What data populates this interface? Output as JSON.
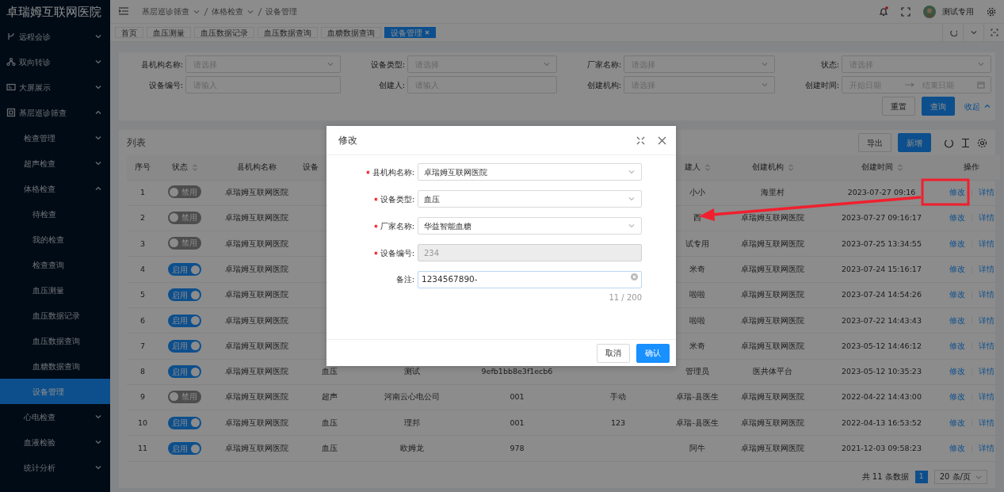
{
  "app": {
    "title": "卓瑞姆互联网医院"
  },
  "sidebar": {
    "items": [
      {
        "label": "远程会诊",
        "expanded": false,
        "selected": false
      },
      {
        "label": "双向转诊",
        "expanded": false,
        "selected": false
      },
      {
        "label": "大屏展示",
        "expanded": false,
        "selected": false
      },
      {
        "label": "基层巡诊筛查",
        "expanded": true,
        "selected": false,
        "children": [
          {
            "label": "检查管理",
            "expanded": false,
            "selected": false
          },
          {
            "label": "超声检查",
            "expanded": false,
            "selected": false
          },
          {
            "label": "体格检查",
            "expanded": true,
            "selected": false,
            "children": [
              {
                "label": "待检查",
                "selected": false
              },
              {
                "label": "我的检查",
                "selected": false
              },
              {
                "label": "检查查询",
                "selected": false
              },
              {
                "label": "血压测量",
                "selected": false
              },
              {
                "label": "血压数据记录",
                "selected": false
              },
              {
                "label": "血压数据查询",
                "selected": false
              },
              {
                "label": "血糖数据查询",
                "selected": false
              },
              {
                "label": "设备管理",
                "selected": true
              }
            ]
          },
          {
            "label": "心电检查",
            "expanded": false,
            "selected": false
          },
          {
            "label": "血液检验",
            "expanded": false,
            "selected": false
          },
          {
            "label": "统计分析",
            "expanded": false,
            "selected": false
          }
        ]
      }
    ]
  },
  "breadcrumbs": [
    {
      "label": "基层巡诊筛查",
      "dropdown": true
    },
    {
      "label": "体格检查",
      "dropdown": true
    },
    {
      "label": "设备管理",
      "dropdown": false
    }
  ],
  "user": {
    "name": "测试专用",
    "notification": true
  },
  "tabs": [
    {
      "label": "首页",
      "selected": false
    },
    {
      "label": "血压测量",
      "selected": false
    },
    {
      "label": "血压数据记录",
      "selected": false
    },
    {
      "label": "血压数据查询",
      "selected": false
    },
    {
      "label": "血糖数据查询",
      "selected": false
    },
    {
      "label": "设备管理",
      "selected": true
    }
  ],
  "filters": [
    {
      "label": "县机构名称:",
      "kind": "select",
      "placeholder": "请选择"
    },
    {
      "label": "设备类型:",
      "kind": "select",
      "placeholder": "请选择"
    },
    {
      "label": "厂家名称:",
      "kind": "select",
      "placeholder": "请选择"
    },
    {
      "label": "状态:",
      "kind": "select",
      "placeholder": "请选择"
    },
    {
      "label": "设备编号:",
      "kind": "input",
      "placeholder": "请输入"
    },
    {
      "label": "创建人:",
      "kind": "input",
      "placeholder": "请输入"
    },
    {
      "label": "创建机构:",
      "kind": "select",
      "placeholder": "请选择"
    },
    {
      "label": "创建时间:",
      "kind": "daterange",
      "placeholder": "开始日期",
      "placeholder_end": "结束日期"
    }
  ],
  "filter_actions": {
    "reset": "重置",
    "search": "查询",
    "collapse": "收起"
  },
  "table": {
    "title": "列表",
    "export": "导出",
    "add": "新增",
    "columns": [
      {
        "label": "序号",
        "sortable": false
      },
      {
        "label": "状态",
        "sortable": true
      },
      {
        "label": "县机构名称",
        "sortable": false
      },
      {
        "label": "设备"
      },
      null,
      null,
      null,
      {
        "label": "建人",
        "sortable": true
      },
      {
        "label": "创建机构",
        "sortable": true
      },
      {
        "label": "创建时间",
        "sortable": true
      },
      {
        "label": "操作",
        "sortable": false
      }
    ],
    "rows": [
      {
        "cells": [
          "1",
          {
            "on": false,
            "label": "禁用"
          },
          "卓瑞姆互联网医院",
          null,
          null,
          null,
          null,
          "小小",
          "海里村",
          "2023-07-27 09:16",
          [
            "修改",
            "详情"
          ]
        ]
      },
      {
        "cells": [
          "2",
          {
            "on": false,
            "label": "禁用"
          },
          "卓瑞姆互联网医院",
          null,
          null,
          null,
          null,
          "西",
          "卓瑞姆互联网医院",
          "2023-07-27 09:16:17",
          [
            "修改",
            "详情"
          ]
        ]
      },
      {
        "cells": [
          "3",
          {
            "on": false,
            "label": "禁用"
          },
          "卓瑞姆互联网医院",
          null,
          null,
          null,
          null,
          "试专用",
          "卓瑞姆互联网医院",
          "2023-07-25 13:34:55",
          [
            "修改",
            "详情"
          ]
        ]
      },
      {
        "cells": [
          "4",
          {
            "on": true,
            "label": "启用"
          },
          "卓瑞姆互联网医院",
          null,
          null,
          null,
          null,
          "米奇",
          "卓瑞姆互联网医院",
          "2023-07-24 15:16:17",
          [
            "修改",
            "详情"
          ]
        ]
      },
      {
        "cells": [
          "5",
          {
            "on": true,
            "label": "启用"
          },
          "卓瑞姆互联网医院",
          null,
          null,
          null,
          null,
          "啦啦",
          "卓瑞姆互联网医院",
          "2023-07-24 14:54:26",
          [
            "修改",
            "详情"
          ]
        ]
      },
      {
        "cells": [
          "6",
          {
            "on": true,
            "label": "启用"
          },
          "卓瑞姆互联网医院",
          null,
          null,
          null,
          null,
          "啦啦",
          "卓瑞姆互联网医院",
          "2023-07-22 14:43:43",
          [
            "修改",
            "详情"
          ]
        ]
      },
      {
        "cells": [
          "7",
          {
            "on": true,
            "label": "启用"
          },
          "卓瑞姆互联网医院",
          null,
          null,
          null,
          null,
          "米奇",
          "卓瑞姆互联网医院",
          "2023-05-12 14:46:12",
          [
            "修改",
            "详情"
          ]
        ]
      },
      {
        "cells": [
          "8",
          {
            "on": true,
            "label": "启用"
          },
          "卓瑞姆互联网医院",
          "血压",
          "测试",
          "9efb1bb8e3f1ecb6",
          null,
          "管理员",
          "医共体平台",
          "2023-05-12 10:35:23",
          [
            "修改",
            "详情"
          ]
        ]
      },
      {
        "cells": [
          "9",
          {
            "on": false,
            "label": "禁用"
          },
          "卓瑞姆互联网医院",
          "超声",
          "河南云心电公司",
          "001",
          "手动",
          "卓瑞-县医生",
          "卓瑞姆互联网医院",
          "2022-04-22 14:43:00",
          [
            "修改",
            "详情"
          ]
        ]
      },
      {
        "cells": [
          "10",
          {
            "on": true,
            "label": "启用"
          },
          "卓瑞姆互联网医院",
          "血压",
          "理邦",
          "001",
          "123",
          "卓瑞-县医生",
          "卓瑞姆互联网医院",
          "2022-04-13 16:53:52",
          [
            "修改",
            "详情"
          ]
        ]
      },
      {
        "cells": [
          "11",
          {
            "on": true,
            "label": "启用"
          },
          "卓瑞姆互联网医院",
          "血压",
          "欧姆龙",
          "978",
          null,
          "阿牛",
          "卓瑞姆互联网医院",
          "2021-12-03 09:58:23",
          [
            "修改",
            "详情"
          ]
        ]
      }
    ]
  },
  "pagination": {
    "total": "共 11 条数据",
    "pages": [
      {
        "label": "1",
        "selected": true
      }
    ],
    "page_size": "20 条/页"
  },
  "modal": {
    "title": "修改",
    "fields": [
      {
        "label": "县机构名称:",
        "kind": "select",
        "required": true,
        "value": "卓瑞姆互联网医院",
        "disabled": false
      },
      {
        "label": "设备类型:",
        "kind": "select",
        "required": true,
        "value": "血压",
        "disabled": false
      },
      {
        "label": "厂家名称:",
        "kind": "select",
        "required": true,
        "value": "华益智能血糖",
        "disabled": false
      },
      {
        "label": "设备编号:",
        "kind": "input",
        "required": true,
        "value": "234",
        "disabled": true
      },
      {
        "label": "备注:",
        "kind": "textarea",
        "required": false,
        "value": "1234567890-",
        "counter": "11 / 200",
        "disabled": false
      }
    ],
    "cancel": "取消",
    "confirm": "确认"
  }
}
